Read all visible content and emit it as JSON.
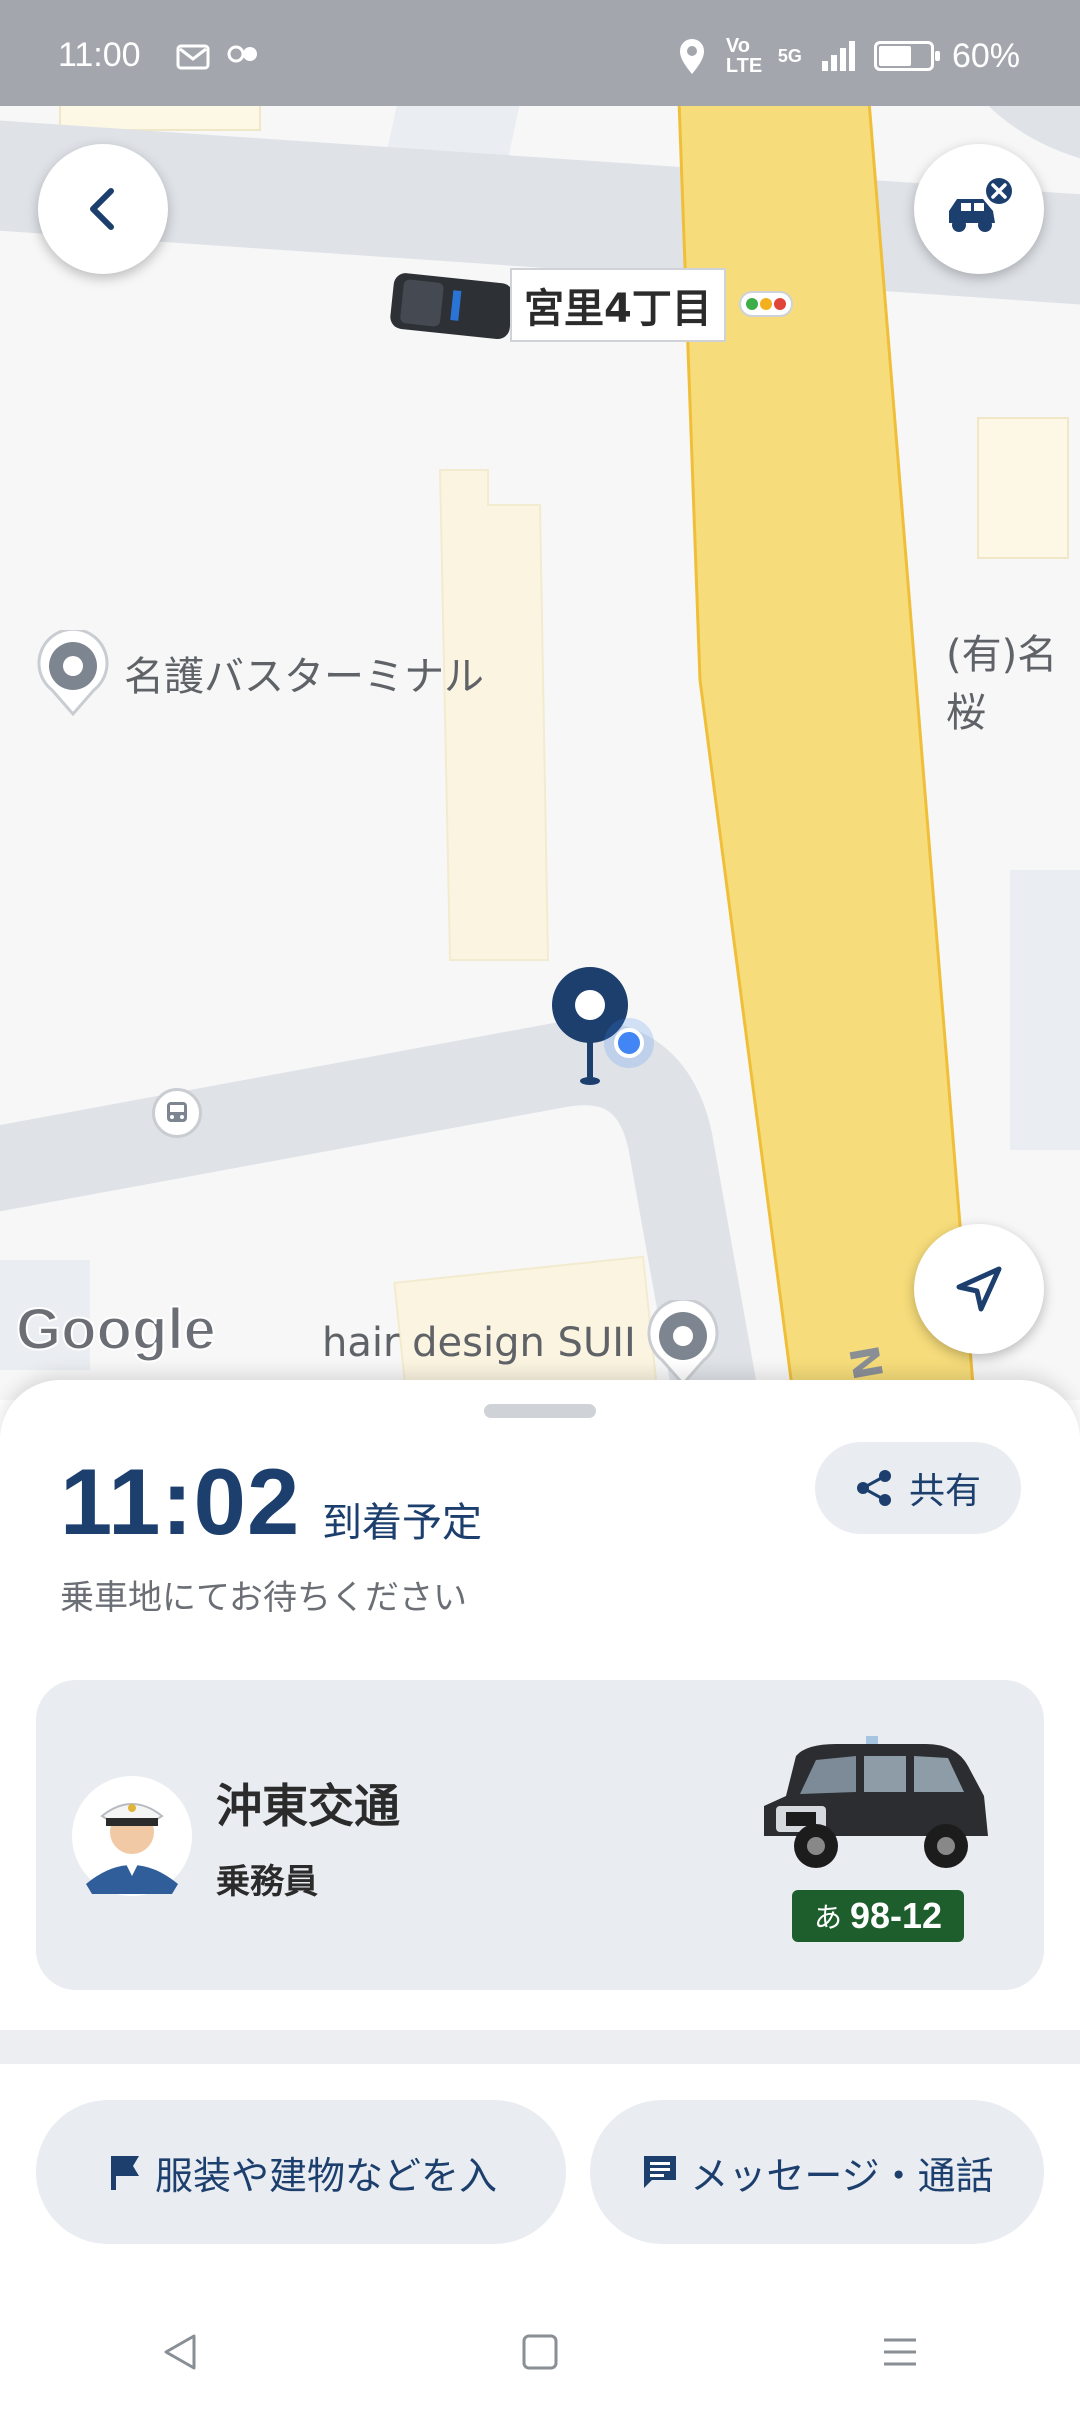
{
  "status_bar": {
    "time": "11:00",
    "network": "5G",
    "volte": "Vo LTE",
    "battery": "60%"
  },
  "map": {
    "intersection_label": "宮里4丁目",
    "poi_bus_terminal": "名護バスターミナル",
    "poi_right_cut": "(有)名桜",
    "poi_hair": "hair design SUII",
    "google_logo": "Google",
    "road_text": "N"
  },
  "sheet": {
    "eta_time": "11:02",
    "eta_label": "到着予定",
    "share_label": "共有",
    "wait_text": "乗車地にてお待ちください",
    "driver": {
      "company": "沖東交通",
      "role": "乗務員",
      "plate_kana": "あ",
      "plate_number": "98-12"
    },
    "actions": {
      "landmark": "服装や建物などを入",
      "message": "メッセージ・通話"
    }
  },
  "colors": {
    "accent": "#1c3f6e",
    "main_road": "#f6dc7a",
    "plate_green": "#1d5e2c",
    "user_location": "#4285f4"
  }
}
